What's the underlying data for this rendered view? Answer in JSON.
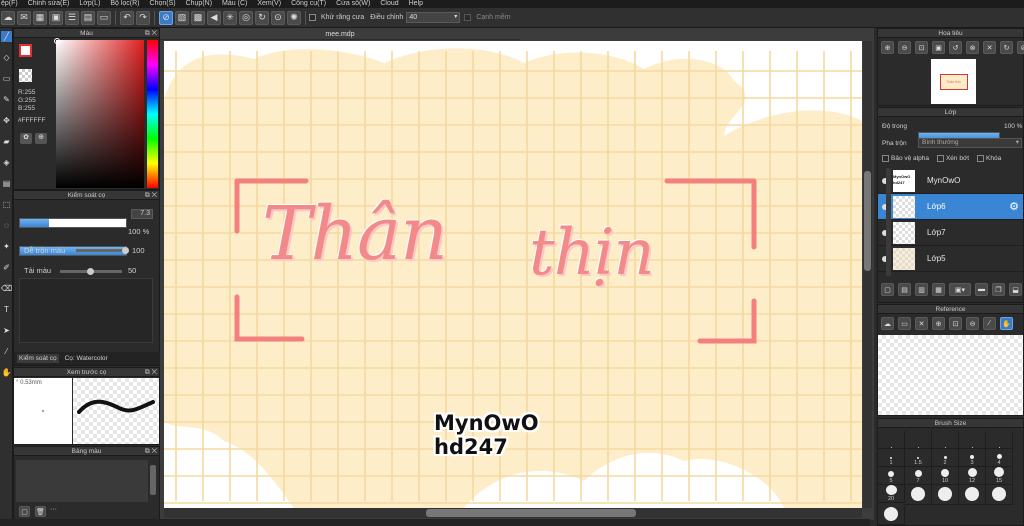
{
  "menu": [
    "ệp(F)",
    "Chỉnh sửa(E)",
    "Lớp(L)",
    "Bộ lọc(R)",
    "Chọn(S)",
    "Chụp(N)",
    "Màu (C)",
    "Xem(V)",
    "Công cụ(T)",
    "Cửa sổ(W)",
    "Cloud",
    "Help"
  ],
  "toolbar": {
    "antialias_label": "Khử răng cưa",
    "adjust_label": "Điều chỉnh",
    "adjust_value": "40",
    "snap_label": "Cạnh mềm"
  },
  "color_panel": {
    "title": "Màu",
    "r": "R:255",
    "g": "G:255",
    "b": "B:255",
    "hex": "#FFFFFF"
  },
  "brush_control": {
    "title": "Kiểm soát cọ",
    "size_value": "7.3",
    "opacity_value": "100 %",
    "size_fraction": 0.27,
    "opacity_fraction": 1.0,
    "blend_label": "Dễ trộn màu",
    "blend_value": "100",
    "blend_fraction": 1.0,
    "load_label": "Tải màu",
    "load_value": "50",
    "load_fraction": 0.5,
    "tab_label": "Kiểm soát cọ",
    "tab_brush": "Cọ: Watercolor"
  },
  "preview": {
    "title": "Xem trước cọ",
    "size_text": "0.53mm"
  },
  "palette": {
    "title": "Bảng màu"
  },
  "canvas": {
    "tab_title": "mee.mdp",
    "title_word1": "Thân",
    "title_word2": "thịn",
    "watermark_line1": "MynOwO",
    "watermark_line2": "hd247"
  },
  "navigator": {
    "title": "Hoa tiêu",
    "thumb_text": "Thân thịn"
  },
  "layers": {
    "title": "Lớp",
    "opacity_label": "Độ trong",
    "opacity_value": "100 %",
    "opacity_fraction": 1.0,
    "blend_label": "Pha trộn",
    "blend_value": "Bình thường",
    "protect_alpha": "Bảo vệ alpha",
    "clip": "Xén bớt",
    "lock": "Khóa",
    "items": [
      {
        "name": "MynOwO",
        "thumb": "MynOwO hd247",
        "selected": false
      },
      {
        "name": "Lớp6",
        "selected": true
      },
      {
        "name": "Lớp7",
        "selected": false
      },
      {
        "name": "Lớp5",
        "selected": false
      }
    ]
  },
  "reference": {
    "title": "Reference"
  },
  "brush_size": {
    "title": "Brush Size",
    "sizes": [
      "1",
      "1.5",
      "2",
      "3",
      "4",
      "5",
      "7",
      "10",
      "12",
      "15",
      "20"
    ]
  },
  "colors": {
    "accent": "#3a86d4",
    "title_pink": "#f28a8a",
    "frame_pink": "#f47f7f",
    "bg_cream": "#fdeec9",
    "grid": "#f5d9a0"
  }
}
